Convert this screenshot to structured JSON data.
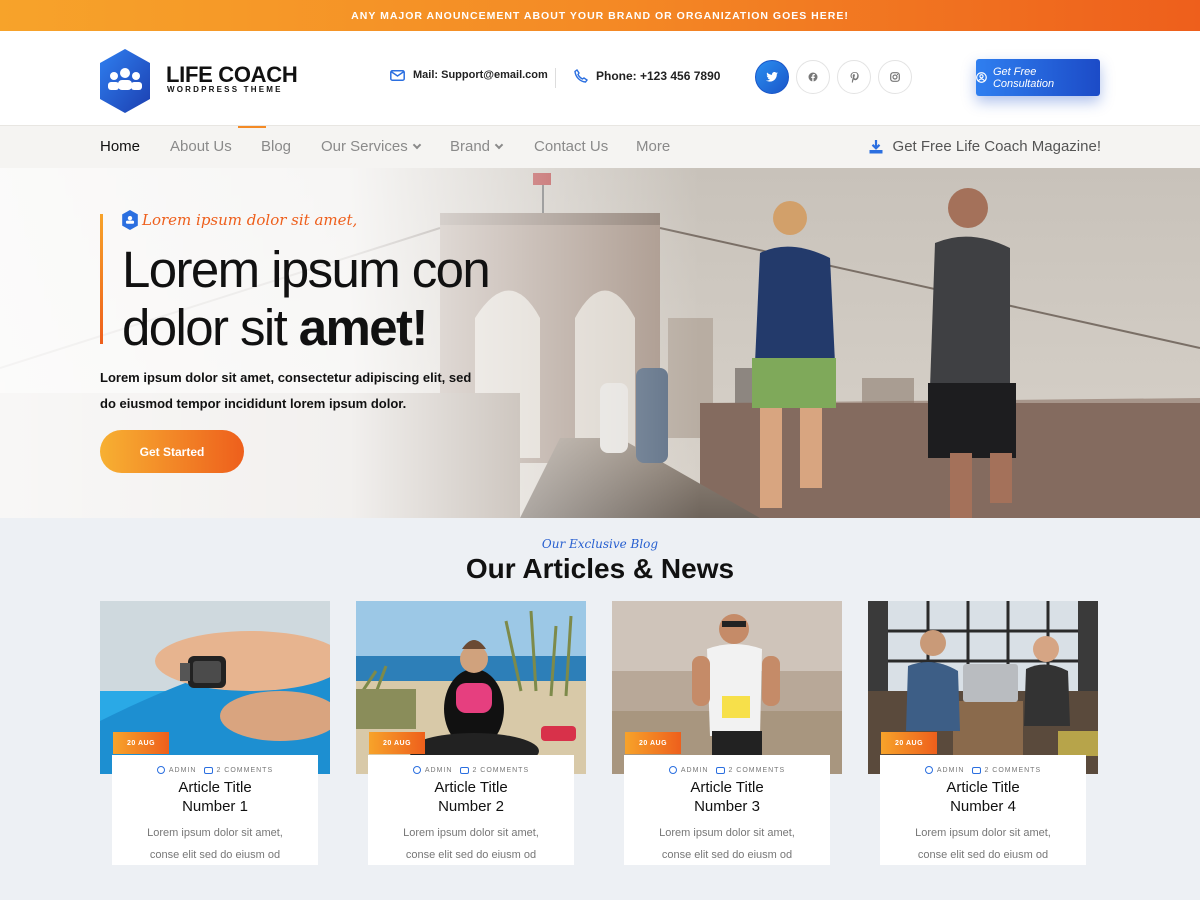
{
  "announcement": "ANY MAJOR ANOUNCEMENT ABOUT YOUR BRAND OR ORGANIZATION GOES HERE!",
  "logo": {
    "title": "LIFE COACH",
    "subtitle": "WORDPRESS THEME",
    "icon": "people-group-icon"
  },
  "contact": {
    "mail": "Mail: Support@email.com",
    "phone": "Phone: +123 456 7890"
  },
  "social": [
    {
      "name": "twitter-icon",
      "active": true
    },
    {
      "name": "facebook-icon",
      "active": false
    },
    {
      "name": "pinterest-icon",
      "active": false
    },
    {
      "name": "instagram-icon",
      "active": false
    }
  ],
  "cta_button": "Get Free Consultation",
  "nav": {
    "items": [
      "Home",
      "About Us",
      "Blog",
      "Our Services",
      "Brand",
      "Contact Us",
      "More"
    ],
    "active_index": 0,
    "magazine": "Get Free Life Coach Magazine!"
  },
  "hero": {
    "tag": "Lorem ipsum dolor sit amet,",
    "headline_line1": "Lorem ipsum con",
    "headline_line2_regular": "dolor sit",
    "headline_line2_bold": "amet!",
    "paragraph": "Lorem ipsum dolor sit amet, consectetur adipiscing elit, sed do eiusmod tempor incididunt lorem ipsum dolor.",
    "button": "Get Started"
  },
  "blog": {
    "kicker": "Our Exclusive Blog",
    "title": "Our Articles & News",
    "cards": [
      {
        "date": "20 AUG",
        "author": "ADMIN",
        "comments": "2 COMMENTS",
        "title_line1": "Article Title",
        "title_line2": "Number 1",
        "text_line1": "Lorem ipsum dolor sit amet,",
        "text_line2": "conse elit sed do eiusm od"
      },
      {
        "date": "20 AUG",
        "author": "ADMIN",
        "comments": "2 COMMENTS",
        "title_line1": "Article Title",
        "title_line2": "Number 2",
        "text_line1": "Lorem ipsum dolor sit amet,",
        "text_line2": "conse elit sed do eiusm od"
      },
      {
        "date": "20 AUG",
        "author": "ADMIN",
        "comments": "2 COMMENTS",
        "title_line1": "Article Title",
        "title_line2": "Number 3",
        "text_line1": "Lorem ipsum dolor sit amet,",
        "text_line2": "conse elit sed do eiusm od"
      },
      {
        "date": "20 AUG",
        "author": "ADMIN",
        "comments": "2 COMMENTS",
        "title_line1": "Article Title",
        "title_line2": "Number 4",
        "text_line1": "Lorem ipsum dolor sit amet,",
        "text_line2": "conse elit sed do eiusm od"
      }
    ]
  },
  "colors": {
    "accent_orange": "#f48a25",
    "accent_blue": "#1c4bc7",
    "background": "#edf0f4"
  }
}
